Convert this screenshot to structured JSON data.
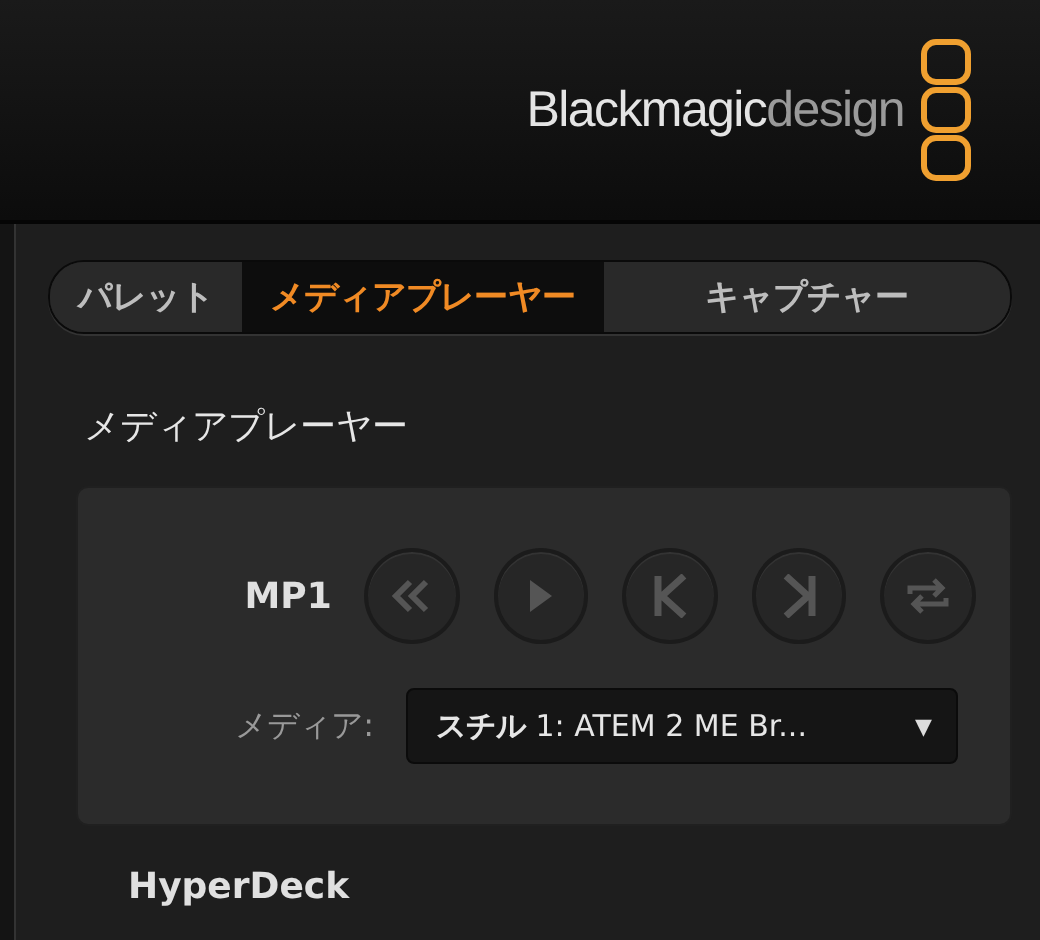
{
  "header": {
    "brand": [
      {
        "text": "Blackmagic",
        "kind": "strong"
      },
      {
        "text": "design",
        "kind": "light"
      }
    ]
  },
  "tabs": [
    {
      "label": "パレット",
      "selected": false
    },
    {
      "label": "メディアプレーヤー",
      "selected": true
    },
    {
      "label": "キャプチャー",
      "selected": false
    }
  ],
  "section_title": "メディアプレーヤー",
  "player": {
    "name": "MP1",
    "buttons": [
      {
        "kind": "rewind",
        "disabled": true
      },
      {
        "kind": "play",
        "disabled": true
      },
      {
        "kind": "previous",
        "disabled": true
      },
      {
        "kind": "next",
        "disabled": true
      },
      {
        "kind": "loop",
        "disabled": true
      }
    ],
    "media_label": "メディア:",
    "media_value": "**スチル** 1: ATEM 2 ME Br...",
    "dropdown_arrow": "▼"
  },
  "next_section_title": "HyperDeck"
}
